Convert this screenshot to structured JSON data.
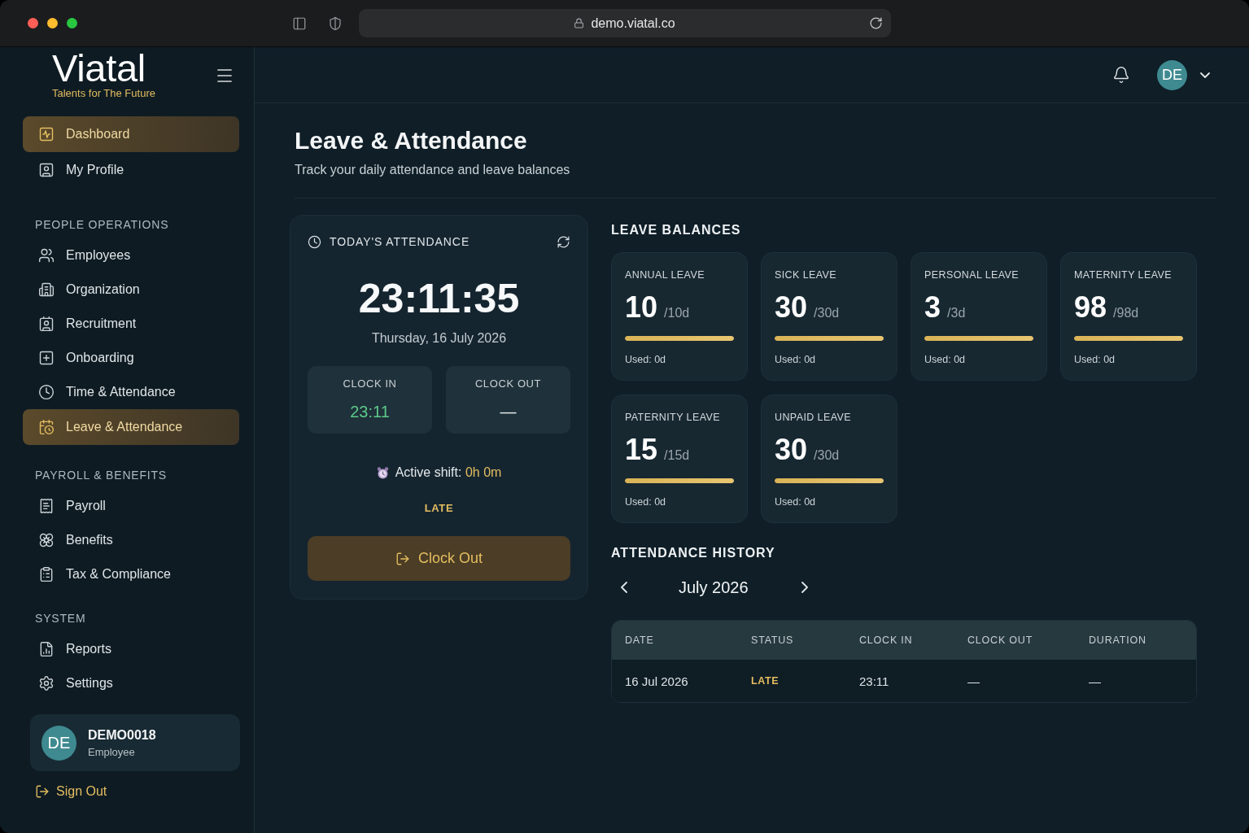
{
  "browser": {
    "url": "demo.viatal.co"
  },
  "sidebar": {
    "logo": "Viatal",
    "tagline": "Talents for The Future",
    "top_items": [
      {
        "label": "Dashboard",
        "selected": true
      },
      {
        "label": "My Profile",
        "selected": false
      }
    ],
    "sections": [
      {
        "title": "PEOPLE OPERATIONS",
        "items": [
          {
            "label": "Employees",
            "selected": false
          },
          {
            "label": "Organization",
            "selected": false
          },
          {
            "label": "Recruitment",
            "selected": false
          },
          {
            "label": "Onboarding",
            "selected": false
          },
          {
            "label": "Time & Attendance",
            "selected": false
          },
          {
            "label": "Leave & Attendance",
            "selected": true
          }
        ]
      },
      {
        "title": "PAYROLL & BENEFITS",
        "items": [
          {
            "label": "Payroll",
            "selected": false
          },
          {
            "label": "Benefits",
            "selected": false
          },
          {
            "label": "Tax & Compliance",
            "selected": false
          }
        ]
      },
      {
        "title": "SYSTEM",
        "items": [
          {
            "label": "Reports",
            "selected": false
          },
          {
            "label": "Settings",
            "selected": false
          }
        ]
      }
    ],
    "user": {
      "initials": "DE",
      "name": "DEMO0018",
      "role": "Employee"
    },
    "sign_out": "Sign Out"
  },
  "header": {
    "avatar_initials": "DE"
  },
  "page": {
    "title": "Leave & Attendance",
    "subtitle": "Track your daily attendance and leave balances"
  },
  "today": {
    "title": "TODAY'S ATTENDANCE",
    "time": "23:11:35",
    "date": "Thursday, 16 July 2026",
    "clock_in": {
      "label": "CLOCK IN",
      "value": "23:11"
    },
    "clock_out": {
      "label": "CLOCK OUT",
      "value": "—"
    },
    "active_shift": {
      "label": "Active shift:",
      "value": "0h 0m"
    },
    "status": "LATE",
    "button": "Clock Out"
  },
  "leave_balances": {
    "title": "LEAVE BALANCES",
    "cards": [
      {
        "name": "ANNUAL LEAVE",
        "remaining": "10",
        "total": "/10d",
        "level": 1,
        "used": "Used: 0d"
      },
      {
        "name": "SICK LEAVE",
        "remaining": "30",
        "total": "/30d",
        "level": 1,
        "used": "Used: 0d"
      },
      {
        "name": "PERSONAL LEAVE",
        "remaining": "3",
        "total": "/3d",
        "level": 1,
        "used": "Used: 0d"
      },
      {
        "name": "MATERNITY LEAVE",
        "remaining": "98",
        "total": "/98d",
        "level": 1,
        "used": "Used: 0d"
      },
      {
        "name": "PATERNITY LEAVE",
        "remaining": "15",
        "total": "/15d",
        "level": 1,
        "used": "Used: 0d"
      },
      {
        "name": "UNPAID LEAVE",
        "remaining": "30",
        "total": "/30d",
        "level": 1,
        "used": "Used: 0d"
      }
    ]
  },
  "attendance_history": {
    "title": "ATTENDANCE HISTORY",
    "month": "July 2026",
    "table": {
      "columns": [
        "DATE",
        "STATUS",
        "CLOCK IN",
        "CLOCK OUT",
        "DURATION"
      ],
      "rows": [
        {
          "date": "16 Jul 2026",
          "status": "LATE",
          "clock_in": "23:11",
          "clock_out": "—",
          "duration": "—"
        }
      ]
    }
  }
}
